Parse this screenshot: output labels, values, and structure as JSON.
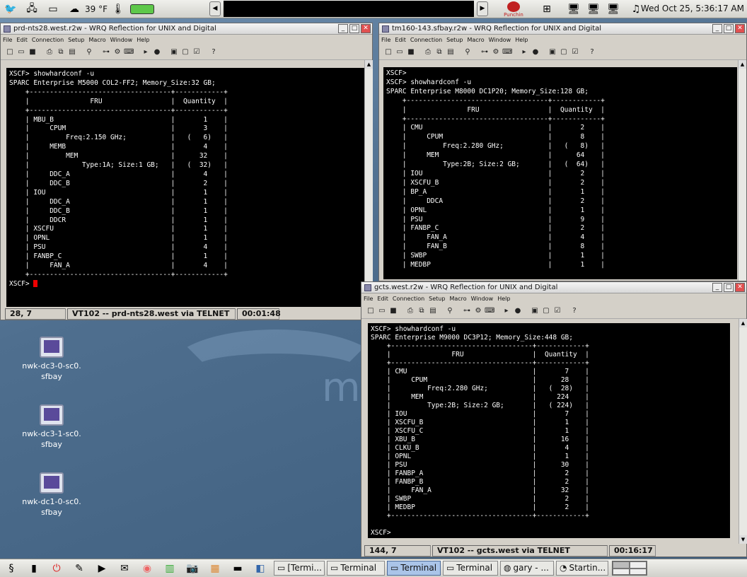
{
  "top_panel": {
    "weather": "39 °F",
    "punchin_label": "Punchin",
    "datetime": "Wed Oct 25, 5:36:17 AM",
    "icons": [
      "distribution-icon",
      "network-icon",
      "drive-icon",
      "weather-icon",
      "thermometer-icon",
      "battery-icon",
      "punchin-icon",
      "network-map-icon",
      "display-icon",
      "display-icon",
      "display-icon",
      "workspace-icon"
    ]
  },
  "windows": [
    {
      "title": "prd-nts28.west.r2w - WRQ Reflection for UNIX and Digital",
      "menu": [
        "File",
        "Edit",
        "Connection",
        "Setup",
        "Macro",
        "Window",
        "Help"
      ],
      "terminal": [
        "XSCF> showhardconf -u",
        "SPARC Enterprise M5000 COL2-FF2; Memory_Size:32 GB;",
        "    +-----------------------------------+------------+",
        "    |               FRU                 |  Quantity  |",
        "    +-----------------------------------+------------+",
        "    | MBU_B                             |       1    |",
        "    |     CPUM                          |       3    |",
        "    |         Freq:2.150 GHz;           |   (   6)   |",
        "    |     MEMB                          |       4    |",
        "    |         MEM                       |      32    |",
        "    |             Type:1A; Size:1 GB;   |   (  32)   |",
        "    |     DDC_A                         |       4    |",
        "    |     DDC_B                         |       2    |",
        "    | IOU                               |       1    |",
        "    |     DDC_A                         |       1    |",
        "    |     DDC_B                         |       1    |",
        "    |     DDCR                          |       1    |",
        "    | XSCFU                             |       1    |",
        "    | OPNL                              |       1    |",
        "    | PSU                               |       4    |",
        "    | FANBP_C                           |       1    |",
        "    |     FAN_A                         |       4    |",
        "    +-----------------------------------+------------+"
      ],
      "prompt": "XSCF> ",
      "status": {
        "position": "28, 7",
        "connection": "VT102 -- prd-nts28.west via TELNET",
        "timer": "00:01:48"
      }
    },
    {
      "title": "tm160-143.sfbay.r2w - WRQ Reflection for UNIX and Digital",
      "menu": [
        "File",
        "Edit",
        "Connection",
        "Setup",
        "Macro",
        "Window",
        "Help"
      ],
      "terminal": [
        "XSCF>",
        "XSCF> showhardconf -u",
        "SPARC Enterprise M8000 DC1P20; Memory_Size:128 GB;",
        "    +-----------------------------------+------------+",
        "    |               FRU                 |  Quantity  |",
        "    +-----------------------------------+------------+",
        "    | CMU                               |       2    |",
        "    |     CPUM                          |       8    |",
        "    |         Freq:2.280 GHz;           |   (   8)   |",
        "    |     MEM                           |      64    |",
        "    |         Type:2B; Size:2 GB;       |   (  64)   |",
        "    | IOU                               |       2    |",
        "    | XSCFU_B                           |       2    |",
        "    | BP_A                              |       1    |",
        "    |     DDCA                          |       2    |",
        "    | OPNL                              |       1    |",
        "    | PSU                               |       9    |",
        "    | FANBP_C                           |       2    |",
        "    |     FAN_A                         |       4    |",
        "    |     FAN_B                         |       8    |",
        "    | SWBP                              |       1    |",
        "    | MEDBP                             |       1    |"
      ]
    },
    {
      "title": "gcts.west.r2w - WRQ Reflection for UNIX and Digital",
      "menu": [
        "File",
        "Edit",
        "Connection",
        "Setup",
        "Macro",
        "Window",
        "Help"
      ],
      "terminal": [
        "XSCF> showhardconf -u",
        "SPARC Enterprise M9000 DC3P12; Memory_Size:448 GB;",
        "    +-----------------------------------+------------+",
        "    |               FRU                 |  Quantity  |",
        "    +-----------------------------------+------------+",
        "    | CMU                               |       7    |",
        "    |     CPUM                          |      28    |",
        "    |         Freq:2.280 GHz;           |   (  28)   |",
        "    |     MEM                           |     224    |",
        "    |         Type:2B; Size:2 GB;       |   ( 224)   |",
        "    | IOU                               |       7    |",
        "    | XSCFU_B                           |       1    |",
        "    | XSCFU_C                           |       1    |",
        "    | XBU_B                             |      16    |",
        "    | CLKU_B                            |       4    |",
        "    | OPNL                              |       1    |",
        "    | PSU                               |      30    |",
        "    | FANBP_A                           |       2    |",
        "    | FANBP_B                           |       2    |",
        "    |     FAN_A                         |      32    |",
        "    | SWBP                              |       2    |",
        "    | MEDBP                             |       2    |",
        "    +-----------------------------------+------------+",
        "",
        "XSCF>"
      ],
      "status": {
        "position": "144, 7",
        "connection": "VT102 -- gcts.west via TELNET",
        "timer": "00:16:17"
      }
    }
  ],
  "desktop_icons": [
    {
      "line1": "nwk-dc3-0-sc0.",
      "line2": "sfbay"
    },
    {
      "line1": "nwk-dc3-1-sc0.",
      "line2": "sfbay"
    },
    {
      "line1": "nwk-dc1-0-sc0.",
      "line2": "sfbay"
    }
  ],
  "taskbar": {
    "tasks": [
      "[Termi...",
      "Terminal",
      "Terminal",
      "Terminal",
      "gary - ...",
      "Startin..."
    ]
  },
  "colors": {
    "terminal_bg": "#000000",
    "terminal_fg": "#ffffff",
    "cursor": "#ee0000",
    "active_task": "#aac4e8"
  }
}
